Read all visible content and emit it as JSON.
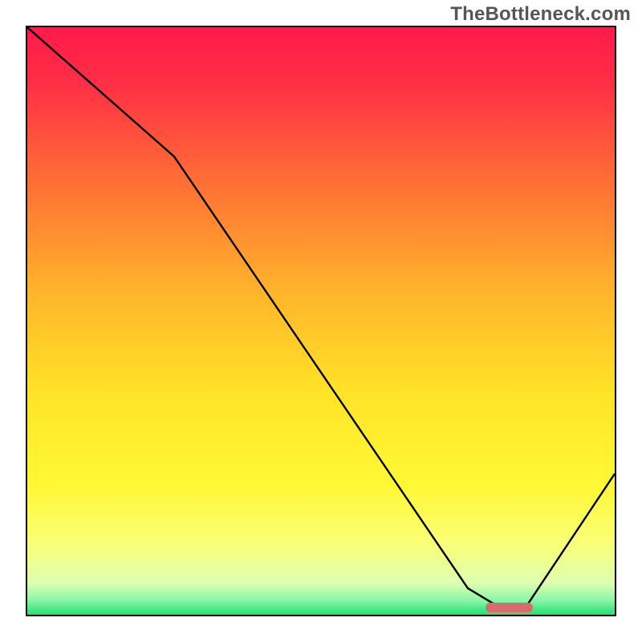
{
  "watermark": "TheBottleneck.com",
  "chart_data": {
    "type": "line",
    "title": "",
    "xlabel": "",
    "ylabel": "",
    "xlim": [
      0,
      100
    ],
    "ylim": [
      0,
      100
    ],
    "x": [
      0,
      25,
      75,
      80,
      85,
      100
    ],
    "values": [
      100,
      78,
      4.5,
      1.5,
      1.5,
      24
    ],
    "gradient_stops": [
      {
        "pos": 0.0,
        "color": "#ff1a4a"
      },
      {
        "pos": 0.1,
        "color": "#ff3045"
      },
      {
        "pos": 0.25,
        "color": "#ff6a36"
      },
      {
        "pos": 0.45,
        "color": "#ffb42b"
      },
      {
        "pos": 0.62,
        "color": "#ffe327"
      },
      {
        "pos": 0.78,
        "color": "#fff835"
      },
      {
        "pos": 0.88,
        "color": "#f9ff77"
      },
      {
        "pos": 0.945,
        "color": "#deffb0"
      },
      {
        "pos": 0.975,
        "color": "#8cf7a8"
      },
      {
        "pos": 1.0,
        "color": "#20e070"
      }
    ],
    "marker": {
      "x_start": 78,
      "x_end": 86,
      "y": 1.2
    },
    "marker_color": "#d96a6e",
    "curve_color": "#000000",
    "curve_width": 2.4
  }
}
